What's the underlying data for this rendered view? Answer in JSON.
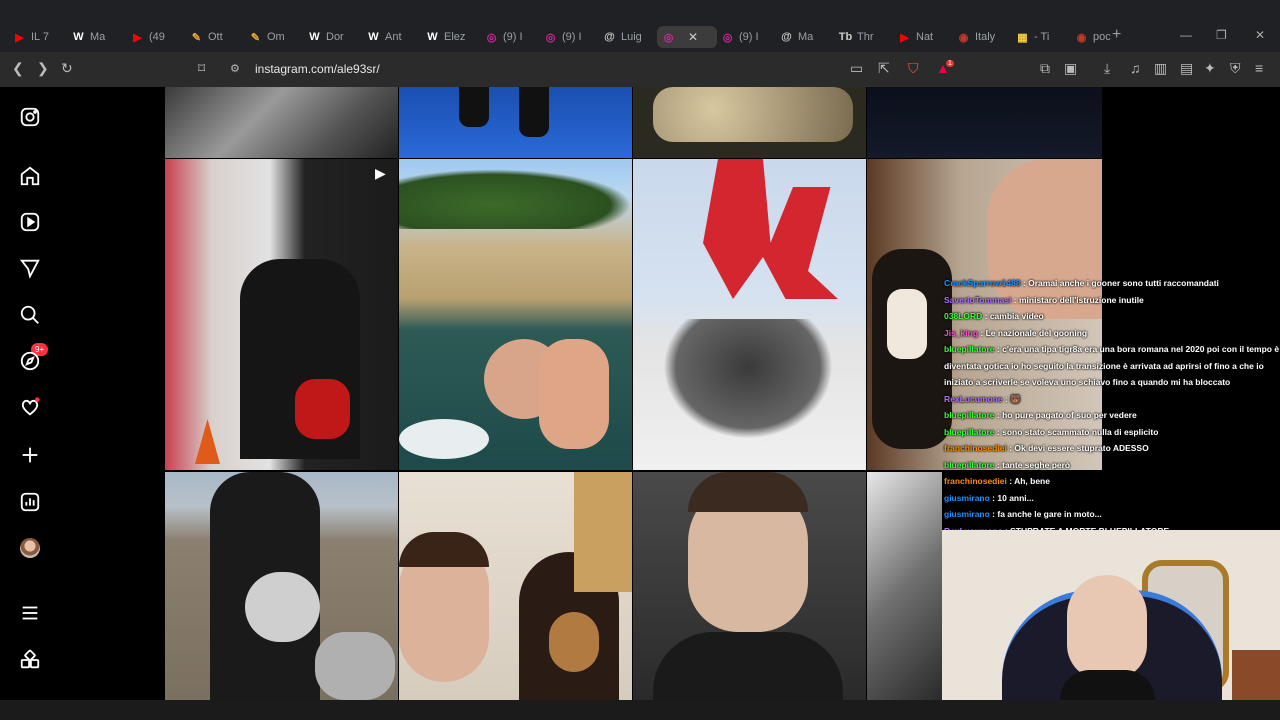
{
  "browser": {
    "tabs": [
      {
        "label": "IL 7",
        "color": "#ff0000",
        "icon": "youtube-icon",
        "glyph": "▶"
      },
      {
        "label": "Ma",
        "color": "#ffffff",
        "icon": "wikipedia-icon",
        "glyph": "W"
      },
      {
        "label": "(49",
        "color": "#ff0000",
        "icon": "youtube-icon",
        "glyph": "▶"
      },
      {
        "label": "Ott",
        "color": "#e8a33c",
        "icon": "bookmark-icon",
        "glyph": "✎"
      },
      {
        "label": "Om",
        "color": "#e8a33c",
        "icon": "bookmark-icon",
        "glyph": "✎"
      },
      {
        "label": "Dor",
        "color": "#ffffff",
        "icon": "wikipedia-icon",
        "glyph": "W"
      },
      {
        "label": "Ant",
        "color": "#ffffff",
        "icon": "wikipedia-icon",
        "glyph": "W"
      },
      {
        "label": "Elez",
        "color": "#ffffff",
        "icon": "wikipedia-icon",
        "glyph": "W"
      },
      {
        "label": "(9) I",
        "color": "#d6249f",
        "icon": "instagram-icon",
        "glyph": "◎"
      },
      {
        "label": "(9) I",
        "color": "#d6249f",
        "icon": "instagram-icon",
        "glyph": "◎"
      },
      {
        "label": "Luig",
        "color": "#cccccc",
        "icon": "threads-icon",
        "glyph": "@"
      },
      {
        "label": "",
        "color": "#d6249f",
        "icon": "instagram-icon",
        "glyph": "◎",
        "active": true
      },
      {
        "label": "(9) I",
        "color": "#d6249f",
        "icon": "instagram-icon",
        "glyph": "◎"
      },
      {
        "label": "Ma",
        "color": "#cccccc",
        "icon": "threads-icon",
        "glyph": "@"
      },
      {
        "label": "Thr",
        "color": "#cccccc",
        "icon": "text-icon",
        "glyph": "Tb"
      },
      {
        "label": "Nat",
        "color": "#ff0000",
        "icon": "youtube-icon",
        "glyph": "▶"
      },
      {
        "label": "Italy",
        "color": "#c0392b",
        "icon": "site-icon",
        "glyph": "◉"
      },
      {
        "label": "- Ti",
        "color": "#f4d03f",
        "icon": "grid-icon",
        "glyph": "▦"
      },
      {
        "label": "poc",
        "color": "#c0392b",
        "icon": "site-icon",
        "glyph": "◉"
      }
    ],
    "url": "instagram.com/ale93sr/",
    "notification_count": "1"
  },
  "sidebar": {
    "notifications_badge": "9+"
  },
  "chat": [
    {
      "user": "CrackSparrow1488",
      "color": "#1e90ff",
      "text": "Oramai anche i gooner sono tutti raccomandati"
    },
    {
      "user": "SaverioTommasi",
      "color": "#b070ff",
      "text": "ministaro dell'istruzione inutile"
    },
    {
      "user": "038LORD",
      "color": "#33ff33",
      "text": "cambia video"
    },
    {
      "user": "Jis_king",
      "color": "#ff4fd8",
      "text": "Le nazionale del gooning"
    },
    {
      "user": "bluepillatore",
      "color": "#33ff33",
      "text": "c'era una tipa tigr8a era una bora romana nel 2020 poi con il tempo è diventata gotica io ho seguito la transizione è arrivata ad aprirsi of fino a che io iniziato a scriverle se voleva uno schiavo fino a quando mi ha bloccato"
    },
    {
      "user": "RexLucumone",
      "color": "#b070ff",
      "text": "🐻"
    },
    {
      "user": "bluepillatore",
      "color": "#33ff33",
      "text": "ho pure pagato of suo per vedere"
    },
    {
      "user": "bluepillatore",
      "color": "#33ff33",
      "text": "sono stato scammato nulla di esplicito"
    },
    {
      "user": "franchinosediei",
      "color": "#ff8c00",
      "text": "Ok devi essere stuprato ADESSO"
    },
    {
      "user": "bluepillatore",
      "color": "#33ff33",
      "text": "tante seghe però"
    },
    {
      "user": "franchinosediei",
      "color": "#ff8c00",
      "text": "Ah, bene"
    },
    {
      "user": "giusmirano",
      "color": "#1e90ff",
      "text": "10 anni..."
    },
    {
      "user": "giusmirano",
      "color": "#1e90ff",
      "text": "fa anche le gare in moto..."
    },
    {
      "user": "RexLucumone",
      "color": "#b070ff",
      "text": "STUPRATE A MORTE BLUEPILLATORE"
    }
  ]
}
